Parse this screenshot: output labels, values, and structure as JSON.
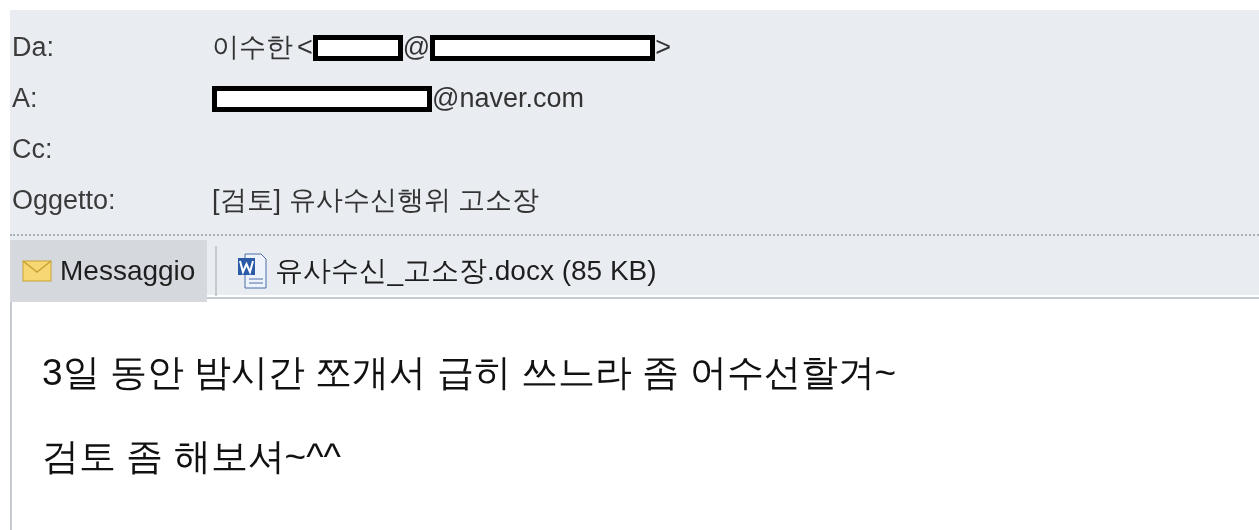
{
  "header": {
    "fields": [
      {
        "label": "Da:",
        "kind": "sender",
        "name": "이수한",
        "open": "<",
        "at": "@",
        "close": ">"
      },
      {
        "label": "A:",
        "kind": "recipient",
        "domain": "@naver.com"
      },
      {
        "label": "Cc:",
        "kind": "empty"
      },
      {
        "label": "Oggetto:",
        "kind": "text",
        "value": "[검토] 유사수신행위 고소장"
      }
    ]
  },
  "tabs": [
    {
      "kind": "message",
      "label": "Messaggio",
      "selected": true
    },
    {
      "kind": "attachment",
      "label": "유사수신_고소장.docx (85 KB)",
      "selected": false
    }
  ],
  "body": {
    "paragraphs": [
      "3일 동안 밤시간 쪼개서 급히 쓰느라 좀 어수선할겨~",
      "검토 좀 해보셔~^^"
    ]
  }
}
